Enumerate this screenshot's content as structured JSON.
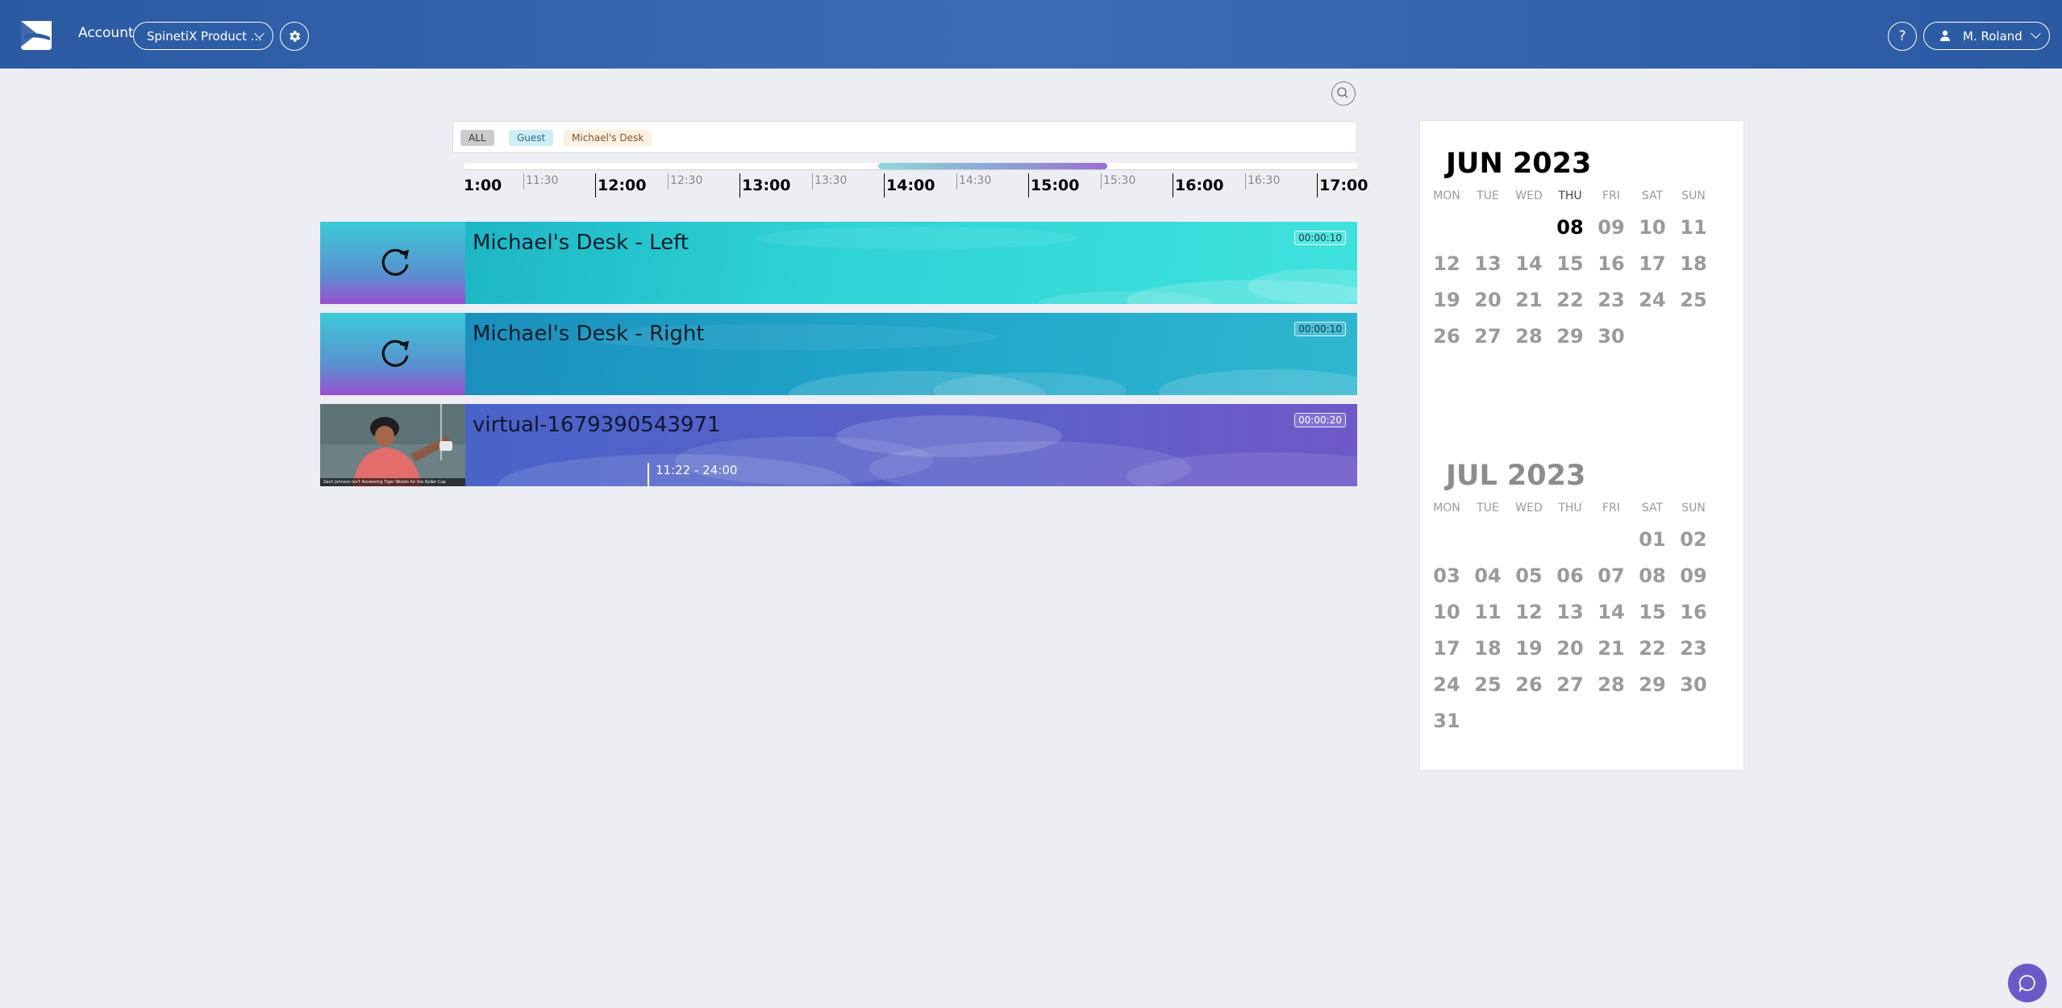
{
  "header": {
    "account_label": "Account",
    "account_select": "SpinetiX Product ...",
    "help_label": "?",
    "user_name": "M. Roland"
  },
  "icons": [
    "spinetix-logo-icon",
    "chevron-down-icon",
    "gear-icon",
    "help-icon",
    "user-icon",
    "zoom-icon",
    "refresh-icon",
    "chat-icon"
  ],
  "filters": [
    {
      "label": "ALL",
      "color": "#c9cbcf"
    },
    {
      "label": "Guest",
      "color": "#cdeef5"
    },
    {
      "label": "Michael's Desk",
      "color": "#fdf0e0"
    }
  ],
  "timeline": {
    "major_ticks": [
      "1:00",
      "12:00",
      "13:00",
      "14:00",
      "15:00",
      "16:00",
      "17:00"
    ],
    "minor_ticks": [
      "11:30",
      "12:30",
      "13:30",
      "14:30",
      "15:30",
      "16:30"
    ]
  },
  "channels": [
    {
      "title": "Michael's Desk - Left",
      "duration": "00:00:10"
    },
    {
      "title": "Michael's Desk - Right",
      "duration": "00:00:10"
    },
    {
      "title": "virtual-1679390543971",
      "duration": "00:00:20",
      "slot": "11:22 - 24:00",
      "photo_caption": "Zach Johnson Isn't Answering Tiger Woods for the Ryder Cup"
    }
  ],
  "calendar": {
    "weekdays": [
      "MON",
      "TUE",
      "WED",
      "THU",
      "FRI",
      "SAT",
      "SUN"
    ],
    "months": [
      {
        "title": "JUN 2023",
        "weeks": [
          [
            "",
            "",
            "",
            "08",
            "09",
            "10",
            "11"
          ],
          [
            "12",
            "13",
            "14",
            "15",
            "16",
            "17",
            "18"
          ],
          [
            "19",
            "20",
            "21",
            "22",
            "23",
            "24",
            "25"
          ],
          [
            "26",
            "27",
            "28",
            "29",
            "30",
            "",
            ""
          ]
        ],
        "today": "08"
      },
      {
        "title": "JUL 2023",
        "weeks": [
          [
            "",
            "",
            "",
            "",
            "",
            "01",
            "02"
          ],
          [
            "03",
            "04",
            "05",
            "06",
            "07",
            "08",
            "09"
          ],
          [
            "10",
            "11",
            "12",
            "13",
            "14",
            "15",
            "16"
          ],
          [
            "17",
            "18",
            "19",
            "20",
            "21",
            "22",
            "23"
          ],
          [
            "24",
            "25",
            "26",
            "27",
            "28",
            "29",
            "30"
          ],
          [
            "31",
            "",
            "",
            "",
            "",
            "",
            ""
          ]
        ]
      }
    ]
  },
  "colors": {
    "header": "#2b5aa3",
    "background": "#eceef3",
    "chat": "#6a5ac8"
  }
}
